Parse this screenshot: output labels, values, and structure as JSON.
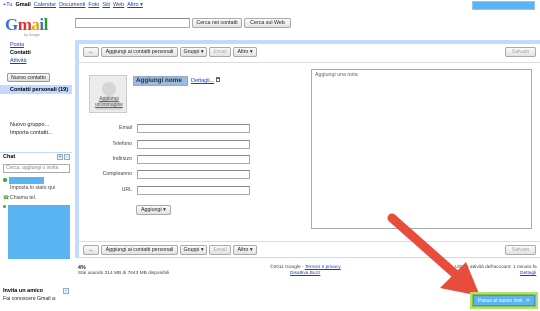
{
  "topnav": {
    "items": [
      "+Tu",
      "Gmail",
      "Calendar",
      "Documenti",
      "Foto",
      "Siti",
      "Web"
    ],
    "more": "Altro ▾"
  },
  "logo": {
    "text": "Gmail",
    "by": "by Google"
  },
  "search": {
    "contacts_button": "Cerca nei contatti",
    "web_button": "Cerca sul Web"
  },
  "sidebar": {
    "items": [
      "Posta",
      "Contatti",
      "Attività"
    ],
    "new_contact": "Nuovo contatto",
    "selected_group": "Contatti personali (19)",
    "new_group": "Nuovo gruppo...",
    "import": "Importa contatti..."
  },
  "chat": {
    "header": "Chat",
    "search_placeholder": "Cerca, aggiungi o invita",
    "set_status": "Imposta lo stato qui",
    "call_phone": "Chiama tel."
  },
  "invite": {
    "header": "Invita un amico",
    "text": "Fai conoscere Gmail a:"
  },
  "toolbar": {
    "back_icon": "←",
    "add_to_personal": "Aggiungi ai contatti personali",
    "groups": "Gruppi ▾",
    "email": "Email",
    "more": "Altro ▾",
    "save": "Salvato"
  },
  "contact": {
    "photo_label": "Aggiungi un'immagine",
    "name": "Aggiungi nome",
    "details": "Dettagli...",
    "fields": [
      "Email",
      "Telefono",
      "Indirizzo",
      "Compleanno",
      "URL"
    ],
    "add_button": "Aggiungi ▾",
    "note_placeholder": "Aggiungi una nota"
  },
  "footer": {
    "usage_pct": "4%",
    "usage_text": "Stai usando 314 MB di 7643 MB disponibili",
    "copyright": "©2011 Google - ",
    "terms": "Termini e privacy",
    "old_version": "Disattiva Buzz",
    "last_activity": "Ultima attività dell'account: 1 minuto fa",
    "details": "Dettagli"
  },
  "new_look": {
    "label": "Passa al nuovo look",
    "close": "✕"
  },
  "colors": {
    "accent_blue": "#5ab4f2",
    "panel_border": "#c3d9ff",
    "arrow_red": "#e84c3d",
    "green_frame": "#8bc34a"
  }
}
